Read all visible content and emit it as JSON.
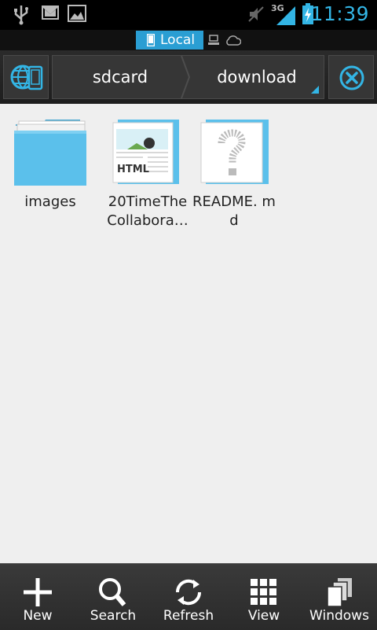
{
  "status_bar": {
    "time": "11:39",
    "network": "3G"
  },
  "location": {
    "local_label": "Local"
  },
  "breadcrumb": [
    "sdcard",
    "download"
  ],
  "files": [
    {
      "name": "images",
      "type": "folder"
    },
    {
      "name": "20TimeThe Collabora…",
      "type": "html",
      "thumb_label": "HTML"
    },
    {
      "name": "README. md",
      "type": "unknown"
    }
  ],
  "bottom_bar": {
    "new": "New",
    "search": "Search",
    "refresh": "Refresh",
    "view": "View",
    "windows": "Windows"
  },
  "colors": {
    "accent": "#33b5e5",
    "folder": "#5bc0eb",
    "local_tab": "#2a9ed3"
  }
}
